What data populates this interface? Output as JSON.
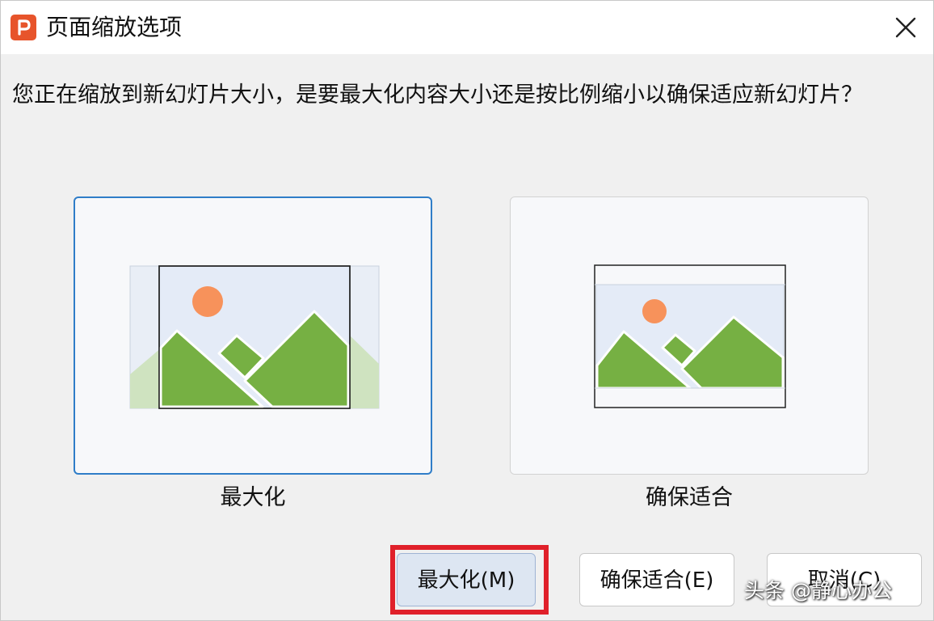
{
  "window": {
    "title": "页面缩放选项",
    "app_icon": "presentation-app-icon",
    "close_icon": "close-icon",
    "accent_color": "#e7542b"
  },
  "message": "您正在缩放到新幻灯片大小，是要最大化内容大小还是按比例缩小以确保适应新幻灯片？",
  "options": [
    {
      "label": "最大化",
      "icon": "maximize-preview-icon",
      "selected": true
    },
    {
      "label": "确保适合",
      "icon": "ensure-fit-preview-icon",
      "selected": false
    }
  ],
  "buttons": {
    "maximize": "最大化(M)",
    "fit": "确保适合(E)",
    "cancel": "取消(C)"
  },
  "watermark": "头条 @静心办公",
  "colors": {
    "selected_border": "#2f7dc8",
    "highlight": "#e0202a",
    "mountain": "#76b043",
    "sun": "#f7925b"
  }
}
